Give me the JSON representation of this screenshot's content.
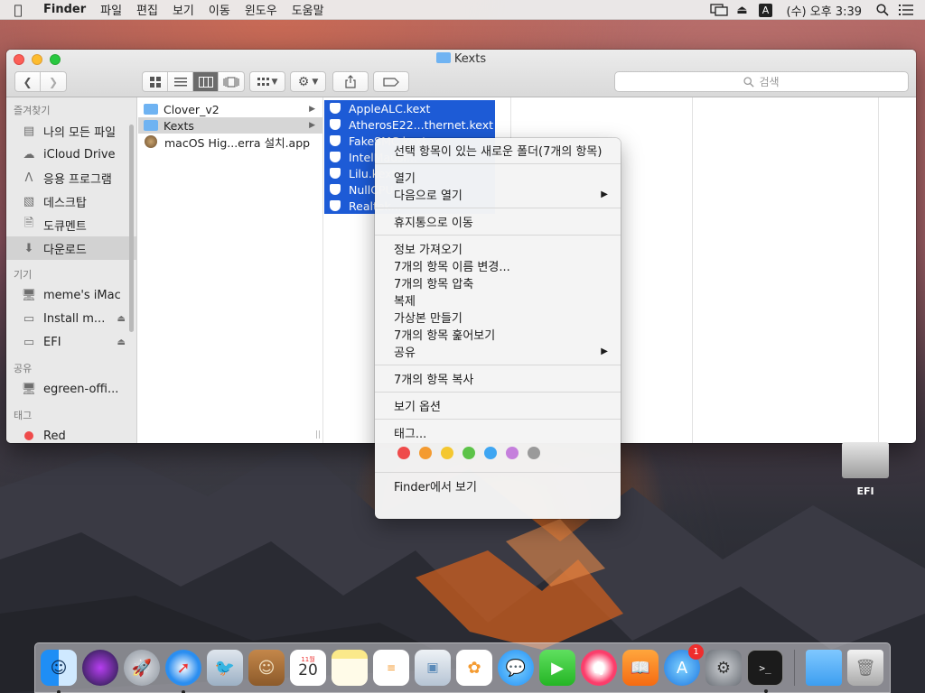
{
  "menubar": {
    "app": "Finder",
    "items": [
      "파일",
      "편집",
      "보기",
      "이동",
      "윈도우",
      "도움말"
    ],
    "input_source": "A",
    "clock": "(수) 오후 3:39"
  },
  "window": {
    "title": "Kexts",
    "search_placeholder": "검색"
  },
  "sidebar": {
    "favorites_head": "즐겨찾기",
    "favorites": [
      "나의 모든 파일",
      "iCloud Drive",
      "응용 프로그램",
      "데스크탑",
      "도큐멘트",
      "다운로드"
    ],
    "devices_head": "기기",
    "devices": [
      "meme's iMac",
      "Install m...",
      "EFI"
    ],
    "shared_head": "공유",
    "shared": [
      "egreen-offi..."
    ],
    "tags_head": "태그",
    "tags": [
      "Red"
    ]
  },
  "column1": [
    "Clover_v2",
    "Kexts",
    "macOS Hig...erra 설치.app"
  ],
  "column2": [
    "AppleALC.kext",
    "AtherosE22...thernet.kext",
    "FakeSMC.kext",
    "IntelMausi...",
    "Lilu.kext",
    "NullCPU...",
    "Realtek..."
  ],
  "context_menu": {
    "new_folder": "선택 항목이 있는 새로운 폴더(7개의 항목)",
    "open": "열기",
    "open_with": "다음으로 열기",
    "trash": "휴지통으로 이동",
    "get_info": "정보 가져오기",
    "rename": "7개의 항목 이름 변경...",
    "compress": "7개의 항목 압축",
    "duplicate": "복제",
    "alias": "가상본 만들기",
    "quicklook": "7개의 항목 훑어보기",
    "share": "공유",
    "copy": "7개의 항목 복사",
    "view_options": "보기 옵션",
    "tags": "태그...",
    "tag_colors": [
      "#ef4b4b",
      "#f49b31",
      "#f4c72f",
      "#5cc348",
      "#3fa6f2",
      "#c57fdc",
      "#9a9a9a"
    ],
    "show_in_finder": "Finder에서 보기"
  },
  "desktop": {
    "efi_label": "EFI"
  },
  "dock": {
    "calendar_month": "11월",
    "calendar_day": "20",
    "appstore_badge": "1"
  }
}
